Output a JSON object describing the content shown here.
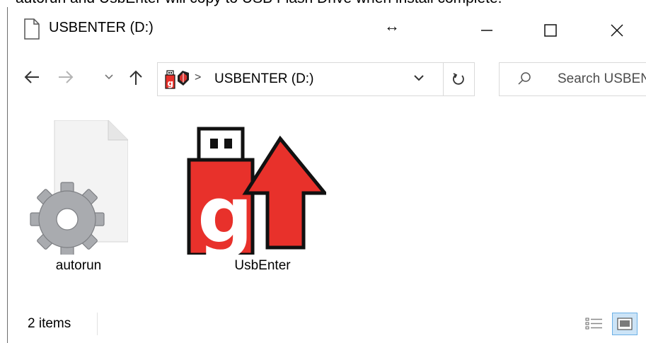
{
  "caption": "autorun and UsbEnter will copy to USB Flash Drive when install complete.",
  "window": {
    "title": "USBENTER (D:)"
  },
  "addressbar": {
    "path": "USBENTER (D:)",
    "search_placeholder": "Search USBENTER (D:)"
  },
  "files": [
    {
      "name": "autorun",
      "icon": "settings-file-icon"
    },
    {
      "name": "UsbEnter",
      "icon": "usbenter-app-icon"
    }
  ],
  "status": {
    "item_count": "2 items"
  },
  "colors": {
    "usb_red": "#e8312b",
    "view_selected": "#cce4f7"
  }
}
